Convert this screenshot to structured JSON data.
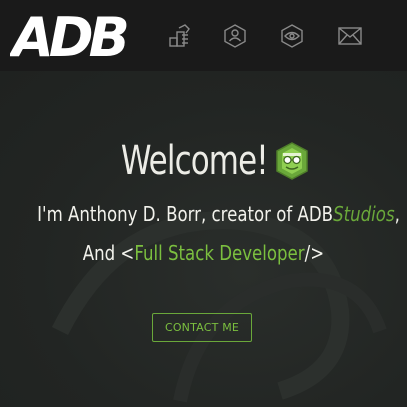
{
  "brand": {
    "logo_text": "ADB"
  },
  "nav": {
    "items": [
      {
        "icon": "tools-icon"
      },
      {
        "icon": "person-hexagon-icon"
      },
      {
        "icon": "eye-hexagon-icon"
      },
      {
        "icon": "envelope-icon"
      }
    ]
  },
  "hero": {
    "welcome": "Welcome!",
    "intro_prefix": "I'm Anthony D. Borr, creator of ADB",
    "intro_studios": "Studios",
    "intro_suffix": ",",
    "role_prefix": "And <",
    "role_title": "Full Stack Developer",
    "role_suffix": "/>",
    "contact_label": "CONTACT ME"
  },
  "colors": {
    "accent": "#7bbf3f",
    "navbar_bg": "#1a1a1a",
    "hero_bg": "#232624",
    "text": "#f2f2ec"
  }
}
